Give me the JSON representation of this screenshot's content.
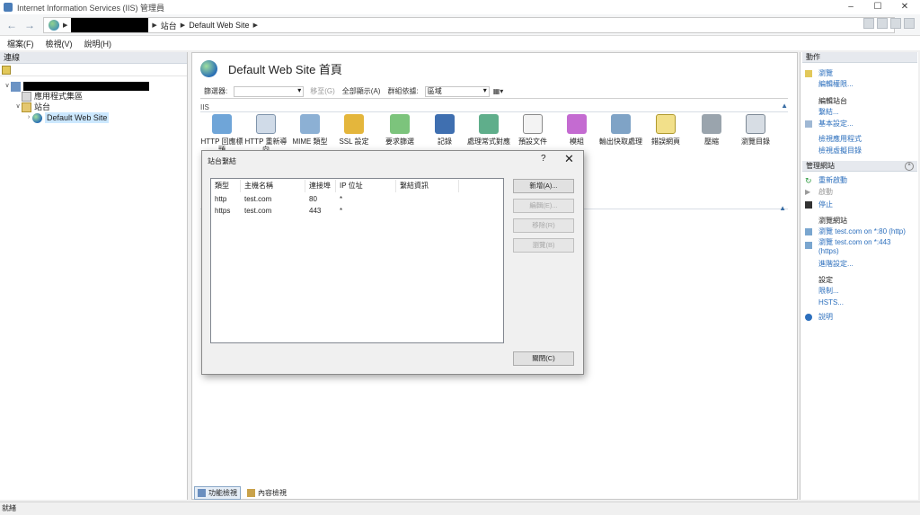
{
  "window": {
    "title": "Internet Information Services (IIS) 管理員",
    "controls": [
      "–",
      "☐",
      "✕"
    ]
  },
  "address": {
    "crumbs": [
      "站台",
      "Default Web Site"
    ]
  },
  "menu": [
    "檔案(F)",
    "檢視(V)",
    "說明(H)"
  ],
  "connections": {
    "header": "連線",
    "tree": {
      "pools": "應用程式集區",
      "sites": "站台",
      "default_site": "Default Web Site"
    }
  },
  "center": {
    "title": "Default Web Site 首頁",
    "filter_label": "篩選器:",
    "go_label": "移至(G)",
    "show_all_label": "全部顯示(A)",
    "group_by_label": "群組依據:",
    "group_by_value": "區域",
    "group_iis": "IIS",
    "features": [
      "HTTP 回應標頭",
      "HTTP 重新導向",
      "MIME 類型",
      "SSL 設定",
      "要求篩選",
      "記錄",
      "處理常式對應",
      "預設文件",
      "模組",
      "輸出快取處理",
      "錯誤網頁",
      "壓縮",
      "瀏覽目錄"
    ],
    "tabs": [
      "功能檢視",
      "內容檢視"
    ]
  },
  "actions": {
    "header": "動作",
    "top": [
      "瀏覽",
      "編輯權限..."
    ],
    "edit_site_label": "編輯站台",
    "edit_site": [
      "繫結...",
      "基本設定...",
      "檢視應用程式",
      "檢視虛擬目錄"
    ],
    "manage_header": "管理網站",
    "manage": [
      "重新啟動",
      "啟動",
      "停止"
    ],
    "browse_label": "瀏覽網站",
    "browse": [
      "瀏覽 test.com on *:80 (http)",
      "瀏覽 test.com on *:443",
      "(https)"
    ],
    "advanced": "進階設定...",
    "config_label": "設定",
    "config": [
      "限制...",
      "HSTS..."
    ],
    "help": "說明"
  },
  "dialog": {
    "title": "站台繫結",
    "help": "?",
    "close": "✕",
    "columns": [
      "類型",
      "主機名稱",
      "連接埠",
      "IP 位址",
      "繫結資訊"
    ],
    "rows": [
      [
        "http",
        "test.com",
        "80",
        "*",
        ""
      ],
      [
        "https",
        "test.com",
        "443",
        "*",
        ""
      ]
    ],
    "buttons": {
      "add": "新增(A)...",
      "edit": "編輯(E)...",
      "remove": "移除(R)",
      "browse": "瀏覽(B)",
      "close": "關閉(C)"
    }
  },
  "status": "就緒",
  "colors": {
    "link": "#2c6fbd",
    "selection": "#cce8ff",
    "pane_header": "#e6e9ee"
  }
}
